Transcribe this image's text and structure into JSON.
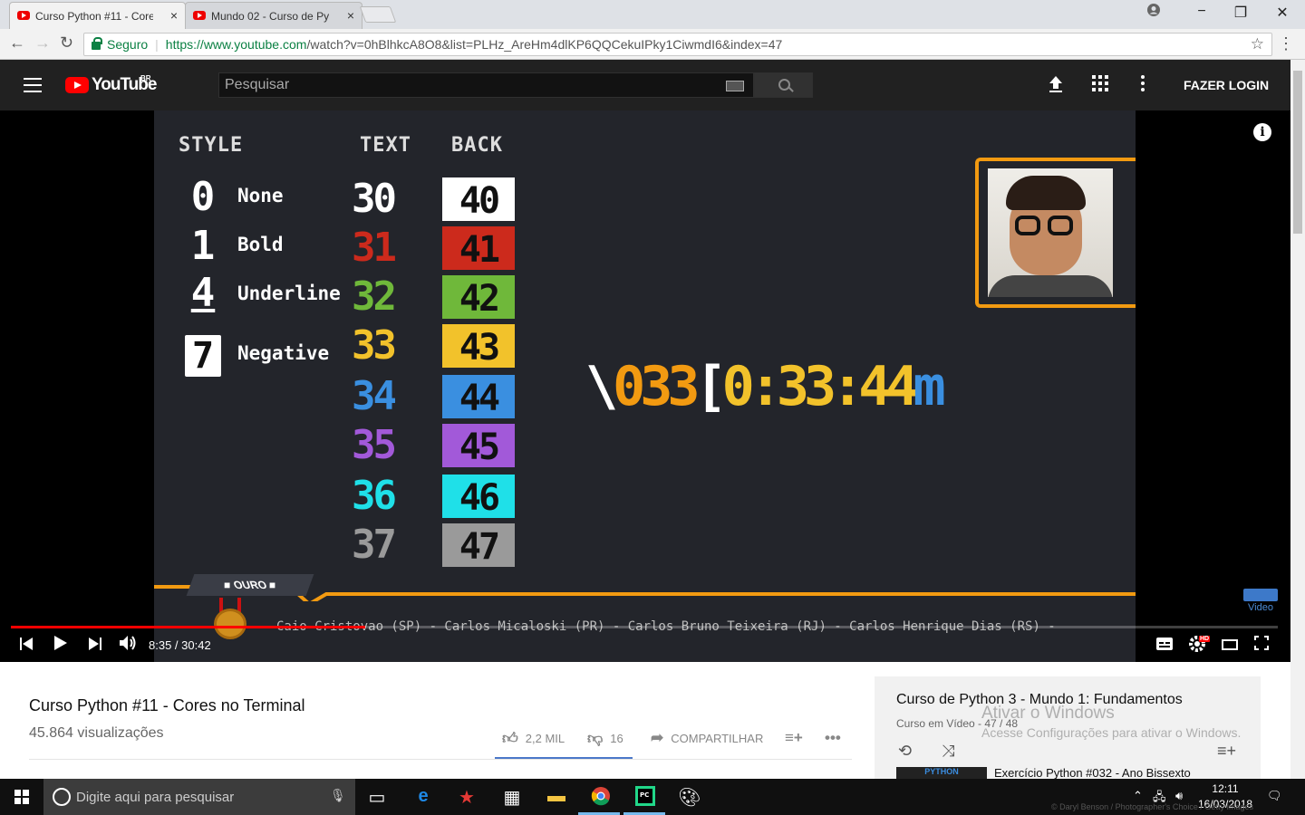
{
  "browser": {
    "tabs": [
      {
        "title": "Curso Python #11 - Core",
        "close": "×"
      },
      {
        "title": "Mundo 02 - Curso de Py",
        "close": "×"
      }
    ],
    "window_controls": [
      "−",
      "❐",
      "✕"
    ],
    "security_label": "Seguro",
    "url_host": "https://www.youtube.com",
    "url_rest": "/watch?v=0hBlhkcA8O8&list=PLHz_AreHm4dlKP6QQCekuIPky1CiwmdI6&index=47"
  },
  "youtube_header": {
    "logo_text": "YouTube",
    "region": "BR",
    "search_placeholder": "Pesquisar",
    "login_label": "FAZER LOGIN"
  },
  "video_frame": {
    "headers": {
      "style": "STYLE",
      "text": "TEXT",
      "back": "BACK"
    },
    "styles": [
      {
        "code": "0",
        "label": "None"
      },
      {
        "code": "1",
        "label": "Bold"
      },
      {
        "code": "4",
        "label": "Underline"
      },
      {
        "code": "7",
        "label": "Negative"
      }
    ],
    "colors": [
      {
        "text": "30",
        "back": "40",
        "hex": "#ffffff"
      },
      {
        "text": "31",
        "back": "41",
        "hex": "#cc2a1c"
      },
      {
        "text": "32",
        "back": "42",
        "hex": "#6fb83a"
      },
      {
        "text": "33",
        "back": "43",
        "hex": "#f2c22b"
      },
      {
        "text": "34",
        "back": "44",
        "hex": "#3a8fe0"
      },
      {
        "text": "35",
        "back": "45",
        "hex": "#a259d9"
      },
      {
        "text": "36",
        "back": "46",
        "hex": "#1fe0e8"
      },
      {
        "text": "37",
        "back": "47",
        "hex": "#9a9a9a"
      }
    ],
    "escape_parts": [
      {
        "text": "\\",
        "color": "#ffffff"
      },
      {
        "text": "033",
        "color": "#f29a11"
      },
      {
        "text": "[",
        "color": "#ffffff"
      },
      {
        "text": "0:33:44",
        "color": "#f2c22b"
      },
      {
        "text": "m",
        "color": "#3a8fe0"
      }
    ],
    "badge": "OURO",
    "crawl": "Caio Cristovao (SP) - Carlos Micaloski (PR) - Carlos Bruno Teixeira (RJ) - Carlos Henrique Dias (RS) -",
    "watermark": "Video",
    "accent_color": "#f29a11"
  },
  "player": {
    "current_time": "8:35",
    "duration": "30:42",
    "time_display": "8:35 / 30:42",
    "progress": 0.28,
    "hd_label": "HD"
  },
  "video_info": {
    "title": "Curso Python #11 - Cores no Terminal",
    "views": "45.864 visualizações",
    "likes": "2,2 MIL",
    "dislikes": "16",
    "share_label": "COMPARTILHAR"
  },
  "playlist": {
    "title": "Curso de Python 3 - Mundo 1: Fundamentos",
    "channel_position": "Curso em Vídeo - 47 / 48",
    "next_thumb_label": "PYTHON",
    "next_title": "Exercício Python #032 - Ano Bissexto"
  },
  "windows_watermark": {
    "line1": "Ativar o Windows",
    "line2": "Acesse Configurações para ativar o Windows."
  },
  "taskbar": {
    "search_placeholder": "Digite aqui para pesquisar",
    "time": "12:11",
    "date": "16/03/2018",
    "copyright": "© Daryl Benson / Photographer's Choice / Getty Images"
  }
}
